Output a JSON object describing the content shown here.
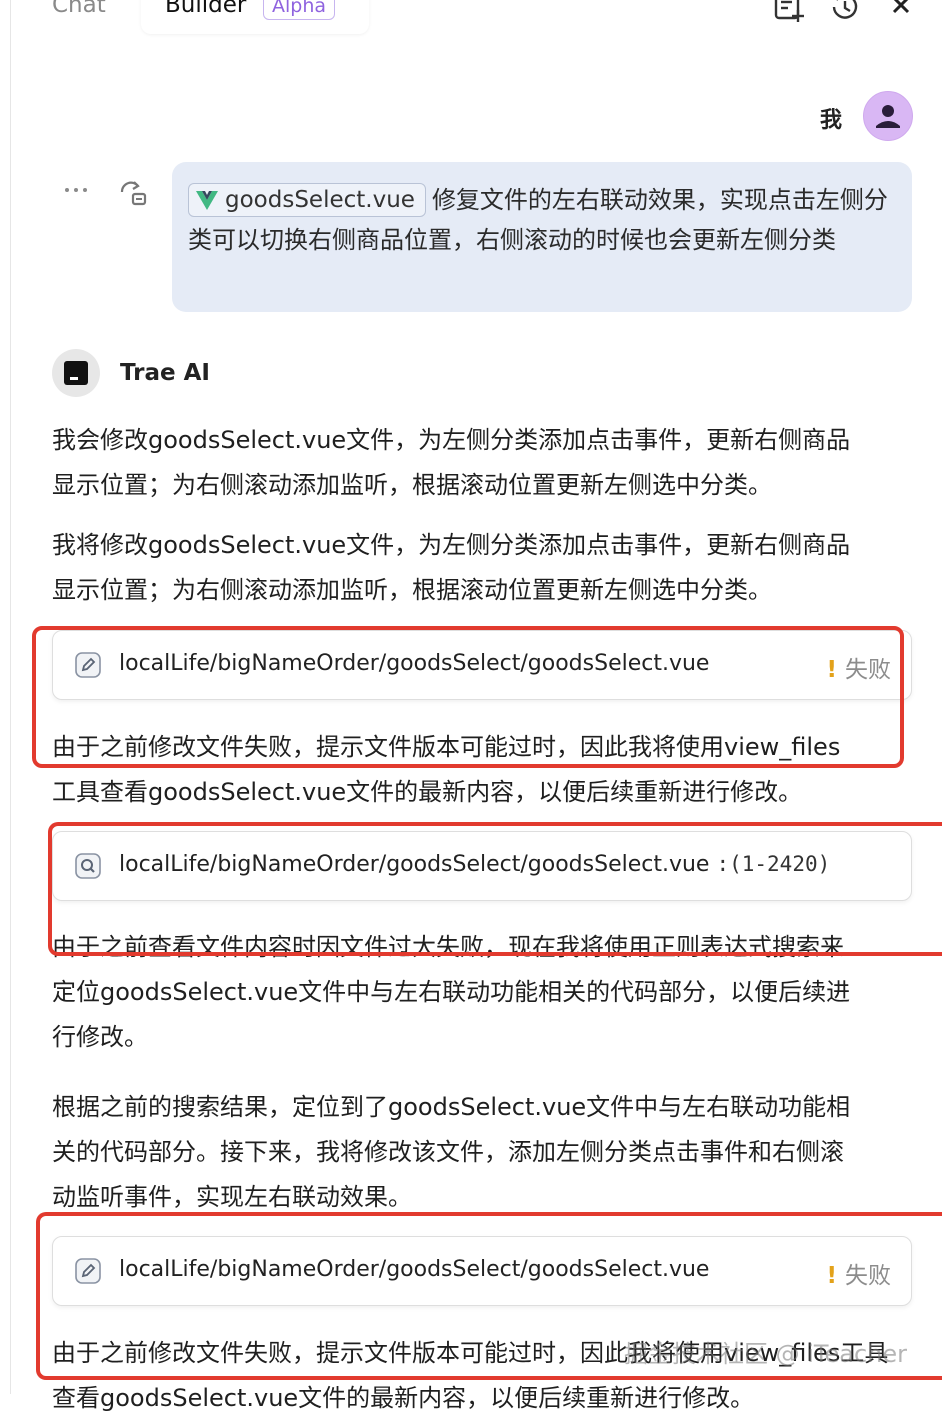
{
  "header": {
    "tab_chat": "Chat",
    "tab_builder": "Builder",
    "builder_badge": "Alpha",
    "icons": [
      "new-chat-icon",
      "history-icon",
      "close-icon"
    ]
  },
  "user": {
    "name": "我",
    "file_chip": "goodsSelect.vue",
    "message_text": "修复文件的左右联动效果，实现点击左侧分类可以切换右侧商品位置，右侧滚动的时候也会更新左侧分类"
  },
  "assistant": {
    "name": "Trae AI",
    "para1_line1": "我会修改goodsSelect.vue文件，为左侧分类添加点击事件，更新右侧商品",
    "para1_line2": "显示位置；为右侧滚动添加监听，根据滚动位置更新左侧选中分类。",
    "para2_line1": "我将修改goodsSelect.vue文件，为左侧分类添加点击事件，更新右侧商品",
    "para2_line2": "显示位置；为右侧滚动添加监听，根据滚动位置更新左侧选中分类。",
    "card1": {
      "path": "localLife/bigNameOrder/goodsSelect/goodsSelect.vue",
      "status": "失败",
      "icon": "edit-icon"
    },
    "para3_line1": "由于之前修改文件失败，提示文件版本可能过时，因此我将使用view_files",
    "para3_line2": "工具查看goodsSelect.vue文件的最新内容，以便后续重新进行修改。",
    "card2": {
      "path": "localLife/bigNameOrder/goodsSelect/goodsSelect.vue",
      "range": ":(1-2420)",
      "icon": "search-icon"
    },
    "para4_line1": "由于之前查看文件内容时因文件过大失败，现在我将使用正则表达式搜索来",
    "para4_line2": "定位goodsSelect.vue文件中与左右联动功能相关的代码部分，以便后续进",
    "para4_line3": "行修改。",
    "para5_line1": "根据之前的搜索结果，定位到了goodsSelect.vue文件中与左右联动功能相",
    "para5_line2": "关的代码部分。接下来，我将修改该文件，添加左侧分类点击事件和右侧滚",
    "para5_line3": "动监听事件，实现左右联动效果。",
    "card3": {
      "path": "localLife/bigNameOrder/goodsSelect/goodsSelect.vue",
      "status": "失败",
      "icon": "edit-icon"
    },
    "para6_line1": "由于之前修改文件失败，提示文件版本可能过时，因此我将使用view_files工具",
    "para6_line2": "查看goodsSelect.vue文件的最新内容，以便后续重新进行修改。"
  },
  "watermark": "掘金技术社区 @ iTeacher",
  "colors": {
    "accent_red": "#e23a2e",
    "warning": "#e3a21a",
    "bubble_bg": "#e5ebf6",
    "badge_purple": "#8f63df"
  }
}
